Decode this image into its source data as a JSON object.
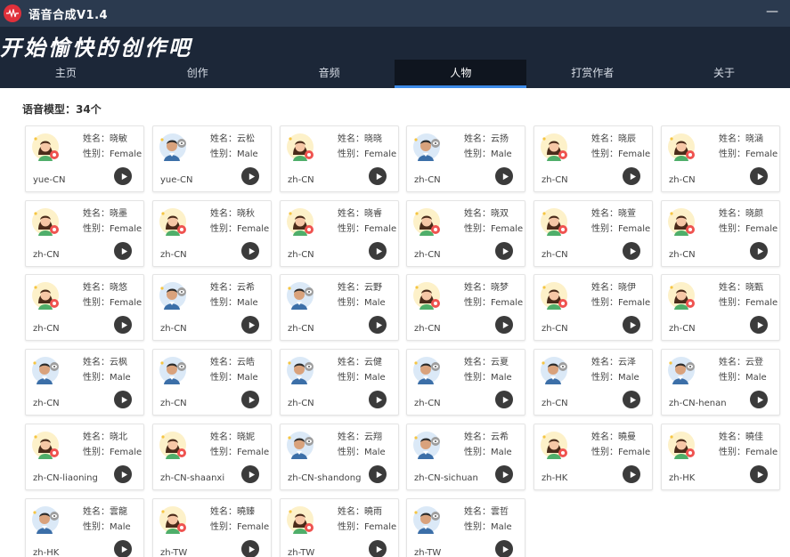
{
  "window": {
    "title": "语音合成V1.4",
    "minimize_label": "—"
  },
  "banner": {
    "slogan": "开始愉快的创作吧"
  },
  "nav": {
    "items": [
      {
        "label": "主页"
      },
      {
        "label": "创作"
      },
      {
        "label": "音频"
      },
      {
        "label": "人物",
        "active": true
      },
      {
        "label": "打赏作者"
      },
      {
        "label": "关于"
      }
    ]
  },
  "content": {
    "section_title": "语音模型：34个",
    "name_prefix": "姓名：",
    "gender_prefix": "性别：",
    "models": [
      {
        "name": "晓敏",
        "gender": "Female",
        "lang": "yue-CN"
      },
      {
        "name": "云松",
        "gender": "Male",
        "lang": "yue-CN"
      },
      {
        "name": "晓晓",
        "gender": "Female",
        "lang": "zh-CN"
      },
      {
        "name": "云扬",
        "gender": "Male",
        "lang": "zh-CN"
      },
      {
        "name": "晓辰",
        "gender": "Female",
        "lang": "zh-CN"
      },
      {
        "name": "晓涵",
        "gender": "Female",
        "lang": "zh-CN"
      },
      {
        "name": "晓墨",
        "gender": "Female",
        "lang": "zh-CN"
      },
      {
        "name": "晓秋",
        "gender": "Female",
        "lang": "zh-CN"
      },
      {
        "name": "晓睿",
        "gender": "Female",
        "lang": "zh-CN"
      },
      {
        "name": "晓双",
        "gender": "Female",
        "lang": "zh-CN"
      },
      {
        "name": "晓萱",
        "gender": "Female",
        "lang": "zh-CN"
      },
      {
        "name": "晓颜",
        "gender": "Female",
        "lang": "zh-CN"
      },
      {
        "name": "晓悠",
        "gender": "Female",
        "lang": "zh-CN"
      },
      {
        "name": "云希",
        "gender": "Male",
        "lang": "zh-CN"
      },
      {
        "name": "云野",
        "gender": "Male",
        "lang": "zh-CN"
      },
      {
        "name": "晓梦",
        "gender": "Female",
        "lang": "zh-CN"
      },
      {
        "name": "晓伊",
        "gender": "Female",
        "lang": "zh-CN"
      },
      {
        "name": "晓甄",
        "gender": "Female",
        "lang": "zh-CN"
      },
      {
        "name": "云枫",
        "gender": "Male",
        "lang": "zh-CN"
      },
      {
        "name": "云皓",
        "gender": "Male",
        "lang": "zh-CN"
      },
      {
        "name": "云健",
        "gender": "Male",
        "lang": "zh-CN"
      },
      {
        "name": "云夏",
        "gender": "Male",
        "lang": "zh-CN"
      },
      {
        "name": "云泽",
        "gender": "Male",
        "lang": "zh-CN"
      },
      {
        "name": "云登",
        "gender": "Male",
        "lang": "zh-CN-henan"
      },
      {
        "name": "晓北",
        "gender": "Female",
        "lang": "zh-CN-liaoning"
      },
      {
        "name": "晓妮",
        "gender": "Female",
        "lang": "zh-CN-shaanxi"
      },
      {
        "name": "云翔",
        "gender": "Male",
        "lang": "zh-CN-shandong"
      },
      {
        "name": "云希",
        "gender": "Male",
        "lang": "zh-CN-sichuan"
      },
      {
        "name": "曉曼",
        "gender": "Female",
        "lang": "zh-HK"
      },
      {
        "name": "曉佳",
        "gender": "Female",
        "lang": "zh-HK"
      },
      {
        "name": "雲龍",
        "gender": "Male",
        "lang": "zh-HK"
      },
      {
        "name": "曉臻",
        "gender": "Female",
        "lang": "zh-TW"
      },
      {
        "name": "曉雨",
        "gender": "Female",
        "lang": "zh-TW"
      },
      {
        "name": "雲哲",
        "gender": "Male",
        "lang": "zh-TW"
      }
    ]
  },
  "colors": {
    "titlebar": "#2b3a4f",
    "banner": "#1c2738",
    "nav_active": "#0f151f",
    "nav_active_underline": "#3d8be8",
    "play_button": "#3b3b3b",
    "female_badge": "#ef5350",
    "male_badge": "#9e9e9e"
  },
  "icons": {
    "app_logo": "audio-wave-icon",
    "female_avatar": "female-avatar-icon",
    "male_avatar": "male-avatar-icon",
    "play": "play-icon"
  }
}
